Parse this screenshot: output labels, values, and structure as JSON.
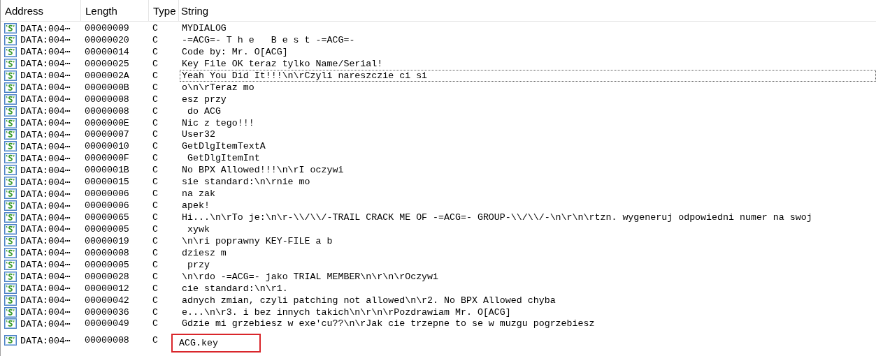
{
  "columns": [
    "Address",
    "Length",
    "Type",
    "String"
  ],
  "rows": [
    {
      "address": "DATA:004⋯",
      "length": "00000009",
      "type": "C",
      "string": "MYDIALOG",
      "focused": false,
      "highlighted": false
    },
    {
      "address": "DATA:004⋯",
      "length": "00000020",
      "type": "C",
      "string": "-=ACG=- T h e   B e s t -=ACG=-",
      "focused": false,
      "highlighted": false
    },
    {
      "address": "DATA:004⋯",
      "length": "00000014",
      "type": "C",
      "string": "Code by: Mr. O[ACG]",
      "focused": false,
      "highlighted": false
    },
    {
      "address": "DATA:004⋯",
      "length": "00000025",
      "type": "C",
      "string": "Key File OK teraz tylko Name/Serial!",
      "focused": false,
      "highlighted": false
    },
    {
      "address": "DATA:004⋯",
      "length": "0000002A",
      "type": "C",
      "string": "Yeah You Did It!!!\\n\\rCzyli nareszczie ci si",
      "focused": true,
      "highlighted": false
    },
    {
      "address": "DATA:004⋯",
      "length": "0000000B",
      "type": "C",
      "string": "o\\n\\rTeraz mo",
      "focused": false,
      "highlighted": false
    },
    {
      "address": "DATA:004⋯",
      "length": "00000008",
      "type": "C",
      "string": "esz przy",
      "focused": false,
      "highlighted": false
    },
    {
      "address": "DATA:004⋯",
      "length": "00000008",
      "type": "C",
      "string": " do ACG",
      "focused": false,
      "highlighted": false
    },
    {
      "address": "DATA:004⋯",
      "length": "0000000E",
      "type": "C",
      "string": "Nic z tego!!!",
      "focused": false,
      "highlighted": false
    },
    {
      "address": "DATA:004⋯",
      "length": "00000007",
      "type": "C",
      "string": "User32",
      "focused": false,
      "highlighted": false
    },
    {
      "address": "DATA:004⋯",
      "length": "00000010",
      "type": "C",
      "string": "GetDlgItemTextA",
      "focused": false,
      "highlighted": false
    },
    {
      "address": "DATA:004⋯",
      "length": "0000000F",
      "type": "C",
      "string": " GetDlgItemInt",
      "focused": false,
      "highlighted": false
    },
    {
      "address": "DATA:004⋯",
      "length": "0000001B",
      "type": "C",
      "string": "No BPX Allowed!!!\\n\\rI oczywi",
      "focused": false,
      "highlighted": false
    },
    {
      "address": "DATA:004⋯",
      "length": "00000015",
      "type": "C",
      "string": "sie standard:\\n\\rnie mo",
      "focused": false,
      "highlighted": false
    },
    {
      "address": "DATA:004⋯",
      "length": "00000006",
      "type": "C",
      "string": "na zak",
      "focused": false,
      "highlighted": false
    },
    {
      "address": "DATA:004⋯",
      "length": "00000006",
      "type": "C",
      "string": "apek!",
      "focused": false,
      "highlighted": false
    },
    {
      "address": "DATA:004⋯",
      "length": "00000065",
      "type": "C",
      "string": "Hi...\\n\\rTo je:\\n\\r-\\\\/\\\\/-TRAIL CRACK ME OF -=ACG=- GROUP-\\\\/\\\\/-\\n\\r\\n\\rtzn. wygeneruj odpowiedni numer na swoj",
      "focused": false,
      "highlighted": false
    },
    {
      "address": "DATA:004⋯",
      "length": "00000005",
      "type": "C",
      "string": " xywk",
      "focused": false,
      "highlighted": false
    },
    {
      "address": "DATA:004⋯",
      "length": "00000019",
      "type": "C",
      "string": "\\n\\ri poprawny KEY-FILE a b",
      "focused": false,
      "highlighted": false
    },
    {
      "address": "DATA:004⋯",
      "length": "00000008",
      "type": "C",
      "string": "dziesz m",
      "focused": false,
      "highlighted": false
    },
    {
      "address": "DATA:004⋯",
      "length": "00000005",
      "type": "C",
      "string": " przy",
      "focused": false,
      "highlighted": false
    },
    {
      "address": "DATA:004⋯",
      "length": "00000028",
      "type": "C",
      "string": "\\n\\rdo -=ACG=- jako TRIAL MEMBER\\n\\r\\n\\rOczywi",
      "focused": false,
      "highlighted": false
    },
    {
      "address": "DATA:004⋯",
      "length": "00000012",
      "type": "C",
      "string": "cie standard:\\n\\r1.",
      "focused": false,
      "highlighted": false
    },
    {
      "address": "DATA:004⋯",
      "length": "00000042",
      "type": "C",
      "string": "adnych zmian, czyli patching not allowed\\n\\r2. No BPX Allowed chyba",
      "focused": false,
      "highlighted": false
    },
    {
      "address": "DATA:004⋯",
      "length": "00000036",
      "type": "C",
      "string": "e...\\n\\r3. i bez innych takich\\n\\r\\n\\rPozdrawiam Mr. O[ACG]",
      "focused": false,
      "highlighted": false
    },
    {
      "address": "DATA:004⋯",
      "length": "00000049",
      "type": "C",
      "string": "Gdzie mi grzebiesz w exe'cu??\\n\\rJak cie trzepne to se w muzgu pogrzebiesz",
      "focused": false,
      "highlighted": false
    },
    {
      "address": "DATA:004⋯",
      "length": "00000008",
      "type": "C",
      "string": "ACG.key",
      "focused": false,
      "highlighted": true
    }
  ]
}
